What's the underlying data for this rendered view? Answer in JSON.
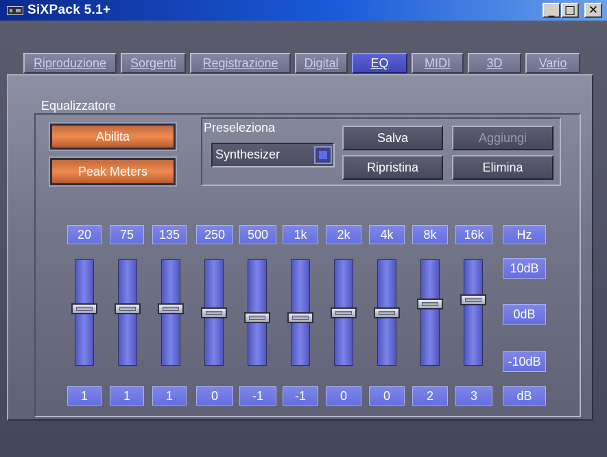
{
  "window": {
    "title": "SiXPack 5.1+",
    "controls": {
      "minimize": "_",
      "maximize": "□",
      "close": "✕"
    }
  },
  "tabs": [
    {
      "label": "Riproduzione",
      "active": false
    },
    {
      "label": "Sorgenti",
      "active": false
    },
    {
      "label": "Registrazione",
      "active": false
    },
    {
      "label": "Digital",
      "active": false
    },
    {
      "label": "EQ",
      "active": true
    },
    {
      "label": "MIDI",
      "active": false
    },
    {
      "label": "3D",
      "active": false
    },
    {
      "label": "Vario",
      "active": false
    }
  ],
  "equalizer": {
    "group_label": "Equalizzatore",
    "enable_label": "Abilita",
    "peak_meters_label": "Peak Meters",
    "preset": {
      "group_label": "Preseleziona",
      "selected": "Synthesizer",
      "save_label": "Salva",
      "add_label": "Aggiungi",
      "restore_label": "Ripristina",
      "delete_label": "Elimina"
    },
    "bands": [
      {
        "freq": "20",
        "value": "1"
      },
      {
        "freq": "75",
        "value": "1"
      },
      {
        "freq": "135",
        "value": "1"
      },
      {
        "freq": "250",
        "value": "0"
      },
      {
        "freq": "500",
        "value": "-1"
      },
      {
        "freq": "1k",
        "value": "-1"
      },
      {
        "freq": "2k",
        "value": "0"
      },
      {
        "freq": "4k",
        "value": "0"
      },
      {
        "freq": "8k",
        "value": "2"
      },
      {
        "freq": "16k",
        "value": "3"
      }
    ],
    "unit_freq": "Hz",
    "unit_gain": "dB",
    "scale": {
      "top": "10dB",
      "mid": "0dB",
      "bottom": "-10dB"
    }
  },
  "colors": {
    "accent_orange": "#ef8a4e",
    "label_blue": "#6e78e6",
    "title_blue": "#1a5ad8"
  }
}
